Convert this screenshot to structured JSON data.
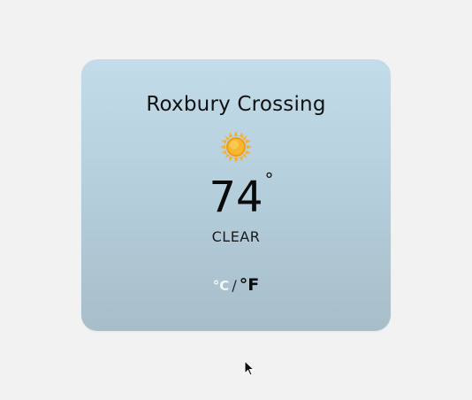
{
  "weather": {
    "location": "Roxbury Crossing",
    "temperature": "74",
    "degree_symbol": "°",
    "condition": "CLEAR",
    "icon": "sun-icon"
  },
  "units": {
    "celsius_label": "°C",
    "separator": "/",
    "fahrenheit_label": "°F"
  },
  "colors": {
    "page_background": "#f2f2f2",
    "card_top": "#c3dcea",
    "card_bottom": "#a7bec9",
    "sun_core": "#f6a623",
    "sun_rays": "#f7c948"
  }
}
